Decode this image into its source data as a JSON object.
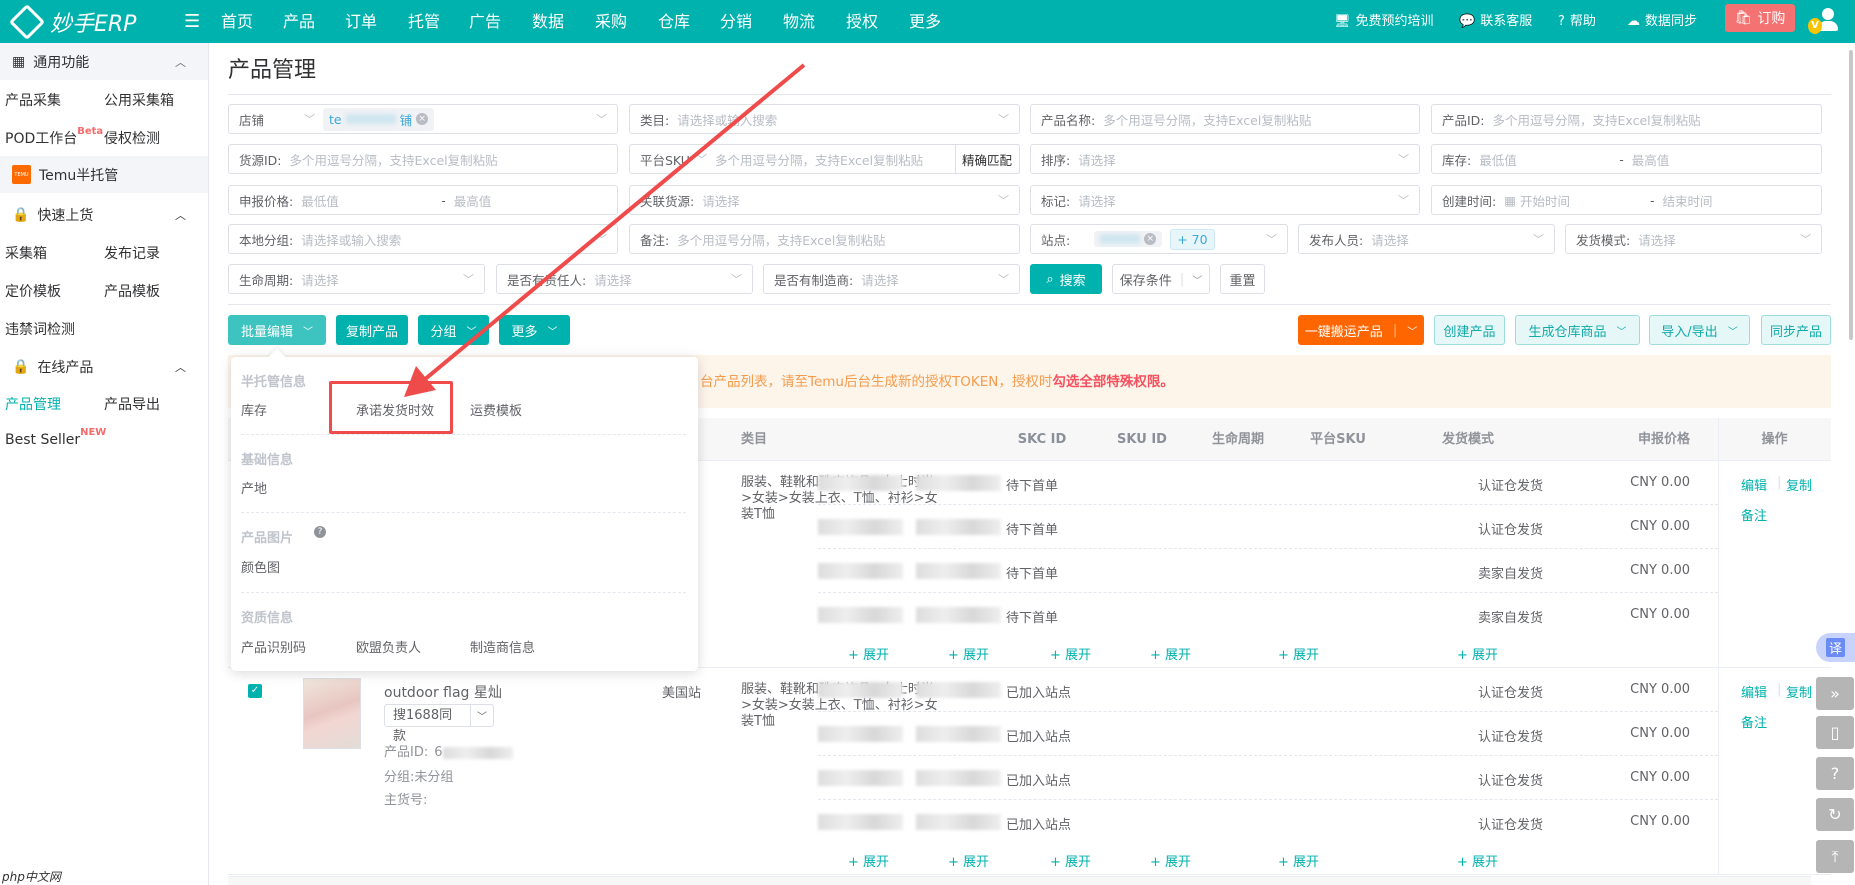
{
  "brand": {
    "name": "妙手ERP"
  },
  "nav": [
    {
      "label": "首页",
      "dot": false
    },
    {
      "label": "产品",
      "dot": false
    },
    {
      "label": "订单",
      "dot": true
    },
    {
      "label": "托管",
      "dot": true
    },
    {
      "label": "广告",
      "dot": false
    },
    {
      "label": "数据",
      "dot": false
    },
    {
      "label": "采购",
      "dot": true
    },
    {
      "label": "仓库",
      "dot": true
    },
    {
      "label": "分销",
      "dot": false
    },
    {
      "label": "物流",
      "dot": false
    },
    {
      "label": "授权",
      "dot": false
    },
    {
      "label": "更多",
      "dot": false
    }
  ],
  "topright": {
    "training": "免费预约培训",
    "service": "联系客服",
    "help": "帮助",
    "sync": "数据同步",
    "order": "订购",
    "avatar_badge": "V"
  },
  "sidebar": {
    "general": "通用功能",
    "general_items": [
      "产品采集",
      "公用采集箱",
      "POD工作台",
      "侵权检测"
    ],
    "beta": "Beta",
    "temu": "Temu半托管",
    "temu_logo": "TEMU",
    "quick": "快速上货",
    "quick_items": [
      "采集箱",
      "发布记录",
      "定价模板",
      "产品模板",
      "违禁词检测"
    ],
    "online": "在线产品",
    "online_items": [
      "产品管理",
      "产品导出",
      "Best Seller"
    ],
    "new": "NEW"
  },
  "page": {
    "title": "产品管理"
  },
  "filters": {
    "shop": {
      "label": "店铺",
      "tag": "te",
      "tag_end": "铺"
    },
    "category": {
      "label": "类目:",
      "placeholder": "请选择或输入搜索"
    },
    "product_name": {
      "label": "产品名称:",
      "placeholder": "多个用逗号分隔，支持Excel复制粘贴"
    },
    "product_id": {
      "label": "产品ID:",
      "placeholder": "多个用逗号分隔，支持Excel复制粘贴"
    },
    "source_id": {
      "label": "货源ID:",
      "placeholder": "多个用逗号分隔，支持Excel复制粘贴"
    },
    "platform_sku": {
      "label": "平台SKU",
      "placeholder": "多个用逗号分隔，支持Excel复制粘贴",
      "match": "精确匹配"
    },
    "sort": {
      "label": "排序:",
      "placeholder": "请选择"
    },
    "stock": {
      "label": "库存:",
      "min": "最低值",
      "max": "最高值"
    },
    "price": {
      "label": "申报价格:",
      "min": "最低值",
      "max": "最高值"
    },
    "linked_source": {
      "label": "关联货源:",
      "placeholder": "请选择"
    },
    "mark": {
      "label": "标记:",
      "placeholder": "请选择"
    },
    "created": {
      "label": "创建时间:",
      "start": "开始时间",
      "end": "结束时间"
    },
    "local_group": {
      "label": "本地分组:",
      "placeholder": "请选择或输入搜索"
    },
    "remark": {
      "label": "备注:",
      "placeholder": "多个用逗号分隔，支持Excel复制粘贴"
    },
    "site": {
      "label": "站点:",
      "more": "+ 70"
    },
    "publisher": {
      "label": "发布人员:",
      "placeholder": "请选择"
    },
    "ship_mode": {
      "label": "发货模式:",
      "placeholder": "请选择"
    },
    "lifecycle": {
      "label": "生命周期:",
      "placeholder": "请选择"
    },
    "responsible": {
      "label": "是否有责任人:",
      "placeholder": "请选择"
    },
    "manufacturer": {
      "label": "是否有制造商:",
      "placeholder": "请选择"
    },
    "search": "搜索",
    "save": "保存条件",
    "reset": "重置",
    "dash": "-"
  },
  "actions": {
    "batch_edit": "批量编辑",
    "copy": "复制产品",
    "group": "分组",
    "more": "更多",
    "move": "一键搬运产品",
    "create": "创建产品",
    "warehouse": "生成仓库商品",
    "import_export": "导入/导出",
    "sync": "同步产品"
  },
  "alert": {
    "text": "台产品列表，请至Temu后台生成新的授权TOKEN，授权时",
    "bold": "勾选全部特殊权限。"
  },
  "batch_menu": {
    "groups": [
      {
        "title": "半托管信息",
        "items": [
          "库存",
          "承诺发货时效",
          "运费模板"
        ]
      },
      {
        "title": "基础信息",
        "items": [
          "产地"
        ]
      },
      {
        "title": "产品图片",
        "items": [
          "颜色图"
        ]
      },
      {
        "title": "资质信息",
        "items": [
          "产品识别码",
          "欧盟负责人",
          "制造商信息"
        ]
      }
    ],
    "highlighted": "承诺发货时效"
  },
  "table": {
    "headers": {
      "category": "类目",
      "skc": "SKC ID",
      "sku": "SKU ID",
      "lifecycle": "生命周期",
      "platform_sku": "平台SKU",
      "ship": "发货模式",
      "price": "申报价格",
      "ops": "操作"
    },
    "expand": "+ 展开",
    "ops": {
      "edit": "编辑",
      "copy": "复制",
      "remark": "备注"
    },
    "rows": [
      {
        "checked": false,
        "site": "",
        "category": "服装、鞋靴和珠宝饰品>女士时尚>女装>女装上衣、T恤、衬衫>女装T恤",
        "skus": [
          {
            "lifecycle": "待下首单",
            "ship": "认证仓发货",
            "price": "CNY 0.00"
          },
          {
            "lifecycle": "待下首单",
            "ship": "认证仓发货",
            "price": "CNY 0.00"
          },
          {
            "lifecycle": "待下首单",
            "ship": "卖家自发货",
            "price": "CNY 0.00"
          },
          {
            "lifecycle": "待下首单",
            "ship": "卖家自发货",
            "price": "CNY 0.00"
          }
        ]
      },
      {
        "checked": true,
        "title": "outdoor flag 星灿",
        "search1688": "搜1688同款",
        "product_id_label": "产品ID:",
        "product_id_prefix": "6",
        "group_label": "分组:",
        "group": "未分组",
        "sku_label": "主货号:",
        "site": "美国站",
        "category": "服装、鞋靴和珠宝饰品>女士时尚>女装>女装上衣、T恤、衬衫>女装T恤",
        "skus": [
          {
            "lifecycle": "已加入站点",
            "ship": "认证仓发货",
            "price": "CNY 0.00"
          },
          {
            "lifecycle": "已加入站点",
            "ship": "认证仓发货",
            "price": "CNY 0.00"
          },
          {
            "lifecycle": "已加入站点",
            "ship": "认证仓发货",
            "price": "CNY 0.00"
          },
          {
            "lifecycle": "已加入站点",
            "ship": "认证仓发货",
            "price": "CNY 0.00"
          }
        ]
      }
    ]
  },
  "floating": {
    "translate": "译"
  },
  "watermark": "php中文网",
  "colors": {
    "brand": "#00b2ae",
    "orange": "#ff6600",
    "alert_bg": "#fdf4ea",
    "annotation": "#f04b4b"
  }
}
